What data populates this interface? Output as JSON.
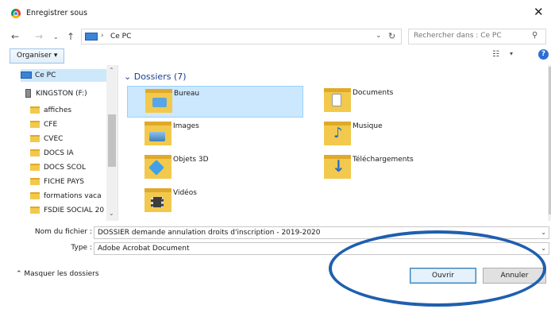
{
  "window": {
    "title": "Enregistrer sous"
  },
  "address": {
    "breadcrumb": "Ce PC",
    "search_placeholder": "Rechercher dans : Ce PC"
  },
  "toolbar": {
    "organize_label": "Organiser"
  },
  "sidebar": {
    "items": [
      {
        "label": "Ce PC",
        "icon": "pc-icon",
        "selected": true
      },
      {
        "label": "KINGSTON (F:)",
        "icon": "drive-icon"
      },
      {
        "label": "affiches",
        "icon": "folder-icon"
      },
      {
        "label": "CFE",
        "icon": "folder-icon"
      },
      {
        "label": "CVEC",
        "icon": "folder-icon"
      },
      {
        "label": "DOCS IA",
        "icon": "folder-icon"
      },
      {
        "label": "DOCS SCOL",
        "icon": "folder-icon"
      },
      {
        "label": "FICHE PAYS",
        "icon": "folder-icon"
      },
      {
        "label": "formations vaca",
        "icon": "folder-icon"
      },
      {
        "label": "FSDIE SOCIAL 20",
        "icon": "folder-icon"
      }
    ]
  },
  "content": {
    "group_title": "Dossiers (7)",
    "folders": [
      {
        "label": "Bureau",
        "icon": "desktop-folder-icon",
        "selected": true
      },
      {
        "label": "Documents",
        "icon": "documents-folder-icon"
      },
      {
        "label": "Images",
        "icon": "images-folder-icon"
      },
      {
        "label": "Musique",
        "icon": "music-folder-icon"
      },
      {
        "label": "Objets 3D",
        "icon": "3d-objects-folder-icon"
      },
      {
        "label": "Téléchargements",
        "icon": "downloads-folder-icon"
      },
      {
        "label": "Vidéos",
        "icon": "videos-folder-icon"
      }
    ]
  },
  "form": {
    "filename_label": "Nom du fichier :",
    "filename_value": "DOSSIER demande annulation droits d'inscription - 2019-2020",
    "type_label": "Type :",
    "type_value": "Adobe Acrobat Document"
  },
  "footer": {
    "hide_folders_label": "Masquer les dossiers",
    "open_label": "Ouvrir",
    "cancel_label": "Annuler"
  },
  "colors": {
    "accent": "#1f5fae",
    "selection": "#cce8ff",
    "folder": "#f2c94c"
  }
}
